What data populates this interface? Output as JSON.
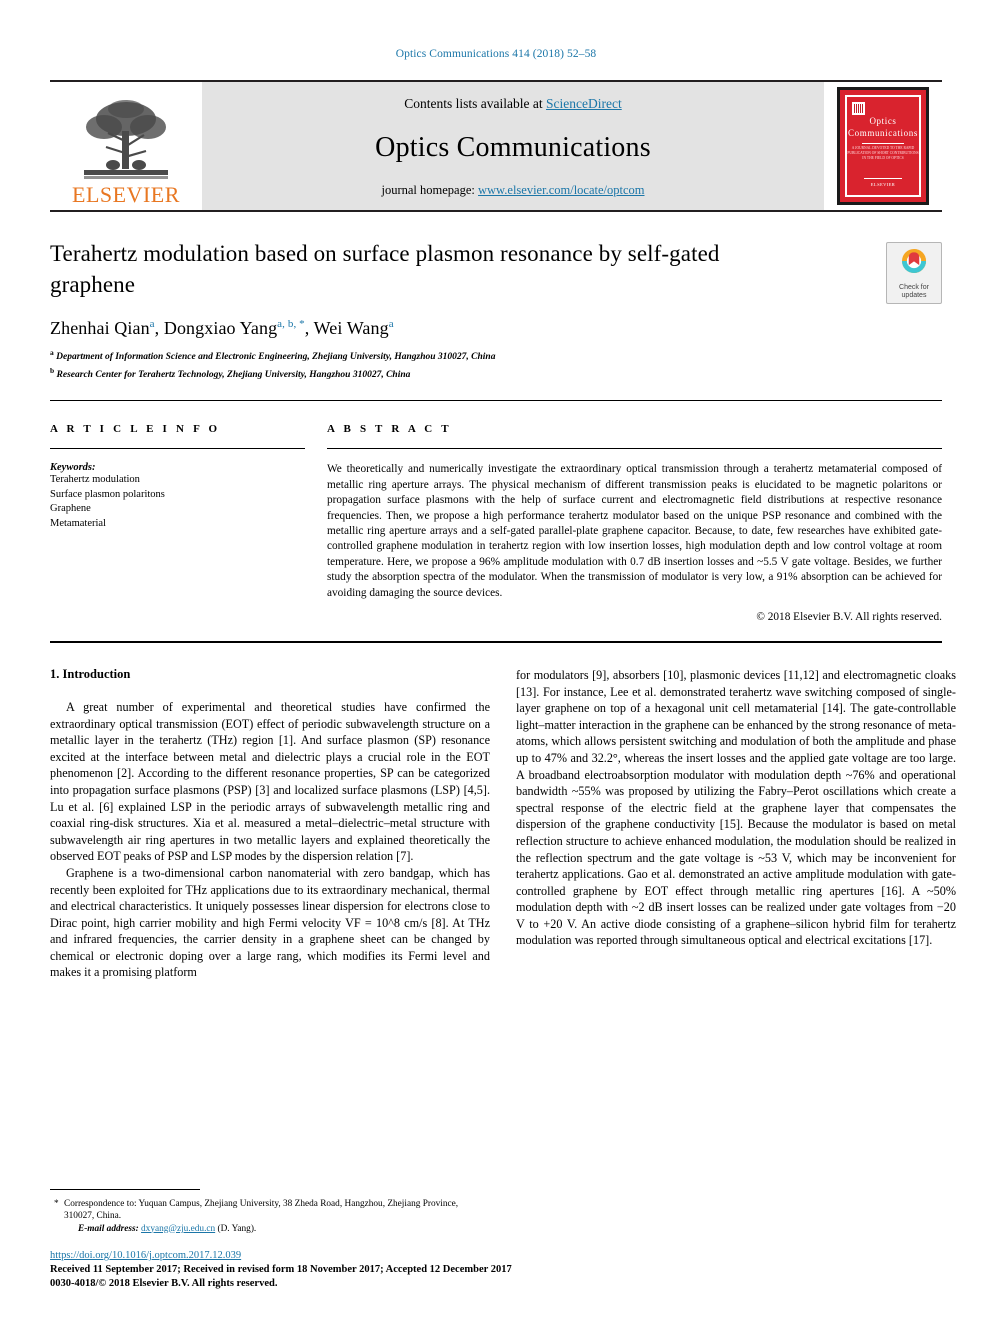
{
  "running_head": "Optics Communications 414 (2018) 52–58",
  "banner": {
    "publisher_logo_text": "ELSEVIER",
    "contents_prefix": "Contents lists available at ",
    "contents_link": "ScienceDirect",
    "journal_name": "Optics Communications",
    "homepage_prefix": "journal homepage: ",
    "homepage_url": "www.elsevier.com/locate/optcom",
    "cover": {
      "line1": "Optics",
      "line2": "Communications",
      "subtitle": "A JOURNAL DEVOTED TO THE RAPID PUBLICATION OF SHORT CONTRIBUTIONS IN THE FIELD OF OPTICS",
      "footer": "ELSEVIER",
      "color": "#d9232e"
    }
  },
  "article": {
    "title": "Terahertz modulation based on surface plasmon resonance by self-gated graphene",
    "authors": [
      {
        "name": "Zhenhai Qian",
        "sup": "a"
      },
      {
        "name": "Dongxiao Yang",
        "sup": "a, b, *"
      },
      {
        "name": "Wei Wang",
        "sup": "a"
      }
    ],
    "authors_line": "Zhenhai Qian",
    "affiliations": [
      {
        "mark": "a",
        "text": "Department of Information Science and Electronic Engineering, Zhejiang University, Hangzhou 310027, China"
      },
      {
        "mark": "b",
        "text": "Research Center for Terahertz Technology, Zhejiang University, Hangzhou 310027, China"
      }
    ],
    "crossmark_label": "Check for updates"
  },
  "info": {
    "heading": "A R T I C L E   I N F O",
    "keywords_label": "Keywords:",
    "keywords": [
      "Terahertz modulation",
      "Surface plasmon polaritons",
      "Graphene",
      "Metamaterial"
    ]
  },
  "abstract": {
    "heading": "A B S T R A C T",
    "text": "We theoretically and numerically investigate the extraordinary  optical transmission through a terahertz metamaterial composed of metallic ring aperture arrays. The physical mechanism of different transmission peaks is elucidated to be magnetic polaritons or propagation surface plasmons with the help of surface current and electromagnetic field distributions at respective resonance frequencies. Then, we propose a high performance terahertz modulator based on the unique PSP resonance and combined with the metallic ring aperture arrays and a self-gated parallel-plate graphene capacitor. Because, to date, few researches have exhibited gate-controlled graphene modulation in terahertz region with low insertion losses, high modulation depth and low control voltage at room temperature. Here, we propose a 96% amplitude modulation with 0.7 dB insertion losses and ~5.5 V gate voltage. Besides, we further study the absorption spectra of the modulator. When the transmission of modulator is very low, a 91% absorption can be achieved for avoiding damaging the source devices.",
    "copyright": "© 2018 Elsevier B.V. All rights reserved."
  },
  "intro": {
    "heading": "1. Introduction",
    "left_paragraphs": [
      "A great number of experimental and theoretical studies have confirmed the extraordinary optical transmission (EOT) effect of periodic subwavelength structure on a metallic layer in the terahertz (THz) region [1]. And surface plasmon (SP) resonance excited at the interface between metal and dielectric plays a crucial role in the EOT phenomenon [2]. According to the different resonance properties, SP can be categorized into propagation surface plasmons (PSP) [3] and localized surface plasmons (LSP) [4,5]. Lu et al. [6] explained LSP in the periodic arrays of subwavelength metallic ring and coaxial ring-disk structures. Xia et al. measured a metal–dielectric–metal structure with subwavelength air ring apertures in two metallic layers and explained theoretically the observed EOT peaks of PSP and LSP modes by the dispersion relation [7].",
      "Graphene is a two-dimensional carbon nanomaterial with zero bandgap, which has recently been exploited for THz applications due to its extraordinary mechanical, thermal and electrical characteristics. It uniquely possesses linear dispersion for electrons close to Dirac point, high carrier mobility and high Fermi velocity VF = 10^8  cm/s [8]. At THz and infrared frequencies, the carrier density in a graphene sheet can be changed by chemical or electronic doping over a large rang, which modifies its Fermi level and makes it a promising platform"
    ],
    "right_paragraphs": [
      "for modulators [9], absorbers [10], plasmonic devices [11,12] and electromagnetic cloaks [13]. For instance, Lee et al. demonstrated terahertz wave switching composed of single-layer graphene on top of a hexagonal unit cell metamaterial [14]. The gate-controllable light–matter interaction in the graphene can be enhanced by the strong resonance of meta-atoms, which allows persistent switching and modulation of both the amplitude and phase up to 47% and 32.2°, whereas the insert losses and the applied gate voltage are too large. A broadband electroabsorption modulator with modulation depth ~76% and operational bandwidth ~55% was proposed by utilizing the Fabry–Perot oscillations which create a spectral response of the electric field at the graphene layer that compensates the dispersion of the graphene conductivity [15]. Because the modulator is based on metal reflection structure to achieve enhanced modulation, the modulation should be realized in the reflection spectrum and the gate voltage is ~53 V, which may be inconvenient for terahertz applications. Gao et al. demonstrated an active amplitude modulation with gate-controlled graphene by EOT effect through metallic ring apertures [16]. A ~50% modulation depth with ~2 dB insert losses can be realized under gate voltages from −20 V to +20 V. An active diode consisting of a graphene–silicon hybrid film for terahertz modulation was reported through simultaneous optical and electrical excitations [17]."
    ]
  },
  "footnote": {
    "correspondence": "Correspondence to: Yuquan Campus, Zhejiang University, 38 Zheda Road, Hangzhou, Zhejiang Province, 310027, China.",
    "email_label": "E-mail address:",
    "email": "dxyang@zju.edu.cn",
    "email_owner": "(D. Yang)."
  },
  "bottom": {
    "doi": "https://doi.org/10.1016/j.optcom.2017.12.039",
    "received": "Received 11 September 2017; Received in revised form 18 November 2017; Accepted 12 December 2017",
    "issn": "0030-4018/© 2018 Elsevier B.V. All rights reserved."
  },
  "colors": {
    "link": "#1b76a8",
    "elsevier_orange": "#e87722",
    "cover_red": "#d9232e",
    "banner_gray": "#e3e3e3"
  }
}
